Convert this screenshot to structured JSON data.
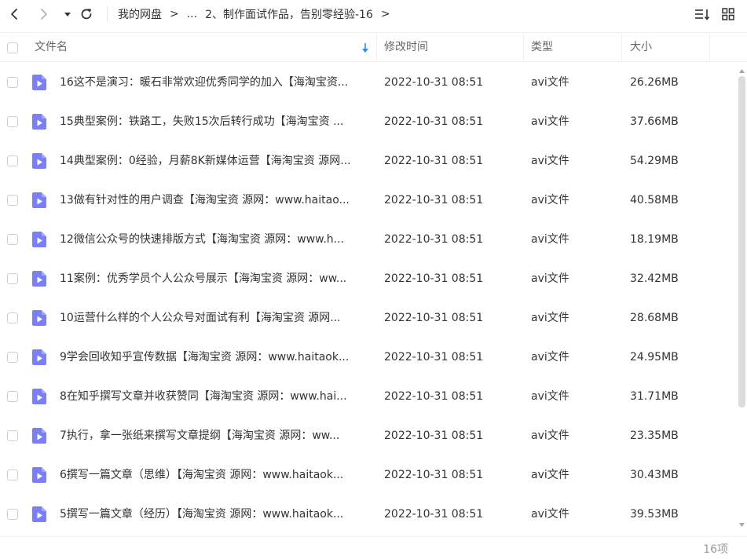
{
  "nav": {
    "back_icon": "chevron-left-icon",
    "forward_icon": "chevron-right-icon",
    "history_icon": "caret-down-icon",
    "refresh_icon": "refresh-icon",
    "list_sort_icon": "list-sort-icon",
    "grid_view_icon": "grid-view-icon"
  },
  "breadcrumb": {
    "root": "我的网盘",
    "separator": ">",
    "ellipsis": "...",
    "current": "2、制作面试作品，告别零经验-16"
  },
  "columns": {
    "name": "文件名",
    "modified": "修改时间",
    "type": "类型",
    "size": "大小"
  },
  "files": [
    {
      "name": "16这不是演习：暖石非常欢迎优秀同学的加入【海淘宝资...",
      "modified": "2022-10-31 08:51",
      "type": "avi文件",
      "size": "26.26MB"
    },
    {
      "name": "15典型案例：铁路工，失败15次后转行成功【海淘宝资 ...",
      "modified": "2022-10-31 08:51",
      "type": "avi文件",
      "size": "37.66MB"
    },
    {
      "name": "14典型案例：0经验，月薪8K新媒体运营【海淘宝资 源网...",
      "modified": "2022-10-31 08:51",
      "type": "avi文件",
      "size": "54.29MB"
    },
    {
      "name": "13做有针对性的用户调查【海淘宝资 源网：www.haitao...",
      "modified": "2022-10-31 08:51",
      "type": "avi文件",
      "size": "40.58MB"
    },
    {
      "name": "12微信公众号的快速排版方式【海淘宝资 源网：www.h...",
      "modified": "2022-10-31 08:51",
      "type": "avi文件",
      "size": "18.19MB"
    },
    {
      "name": "11案例：优秀学员个人公众号展示【海淘宝资 源网：ww...",
      "modified": "2022-10-31 08:51",
      "type": "avi文件",
      "size": "32.42MB"
    },
    {
      "name": "10运营什么样的个人公众号对面试有利【海淘宝资 源网...",
      "modified": "2022-10-31 08:51",
      "type": "avi文件",
      "size": "28.68MB"
    },
    {
      "name": "9学会回收知乎宣传数据【海淘宝资 源网：www.haitaok...",
      "modified": "2022-10-31 08:51",
      "type": "avi文件",
      "size": "24.95MB"
    },
    {
      "name": "8在知乎撰写文章并收获赞同【海淘宝资 源网：www.hai...",
      "modified": "2022-10-31 08:51",
      "type": "avi文件",
      "size": "31.71MB"
    },
    {
      "name": "7执行，拿一张纸来撰写文章提纲【海淘宝资 源网：ww...",
      "modified": "2022-10-31 08:51",
      "type": "avi文件",
      "size": "23.35MB"
    },
    {
      "name": "6撰写一篇文章（思维）【海淘宝资 源网：www.haitaok...",
      "modified": "2022-10-31 08:51",
      "type": "avi文件",
      "size": "30.43MB"
    },
    {
      "name": "5撰写一篇文章（经历）【海淘宝资 源网：www.haitaok...",
      "modified": "2022-10-31 08:51",
      "type": "avi文件",
      "size": "39.53MB"
    }
  ],
  "file_icon": "video-file-icon",
  "footer": {
    "count": "16项"
  },
  "colors": {
    "file_icon": "#7b7ff5",
    "sort_arrow": "#2e8cf0",
    "text": "#333333",
    "muted": "#999999"
  }
}
